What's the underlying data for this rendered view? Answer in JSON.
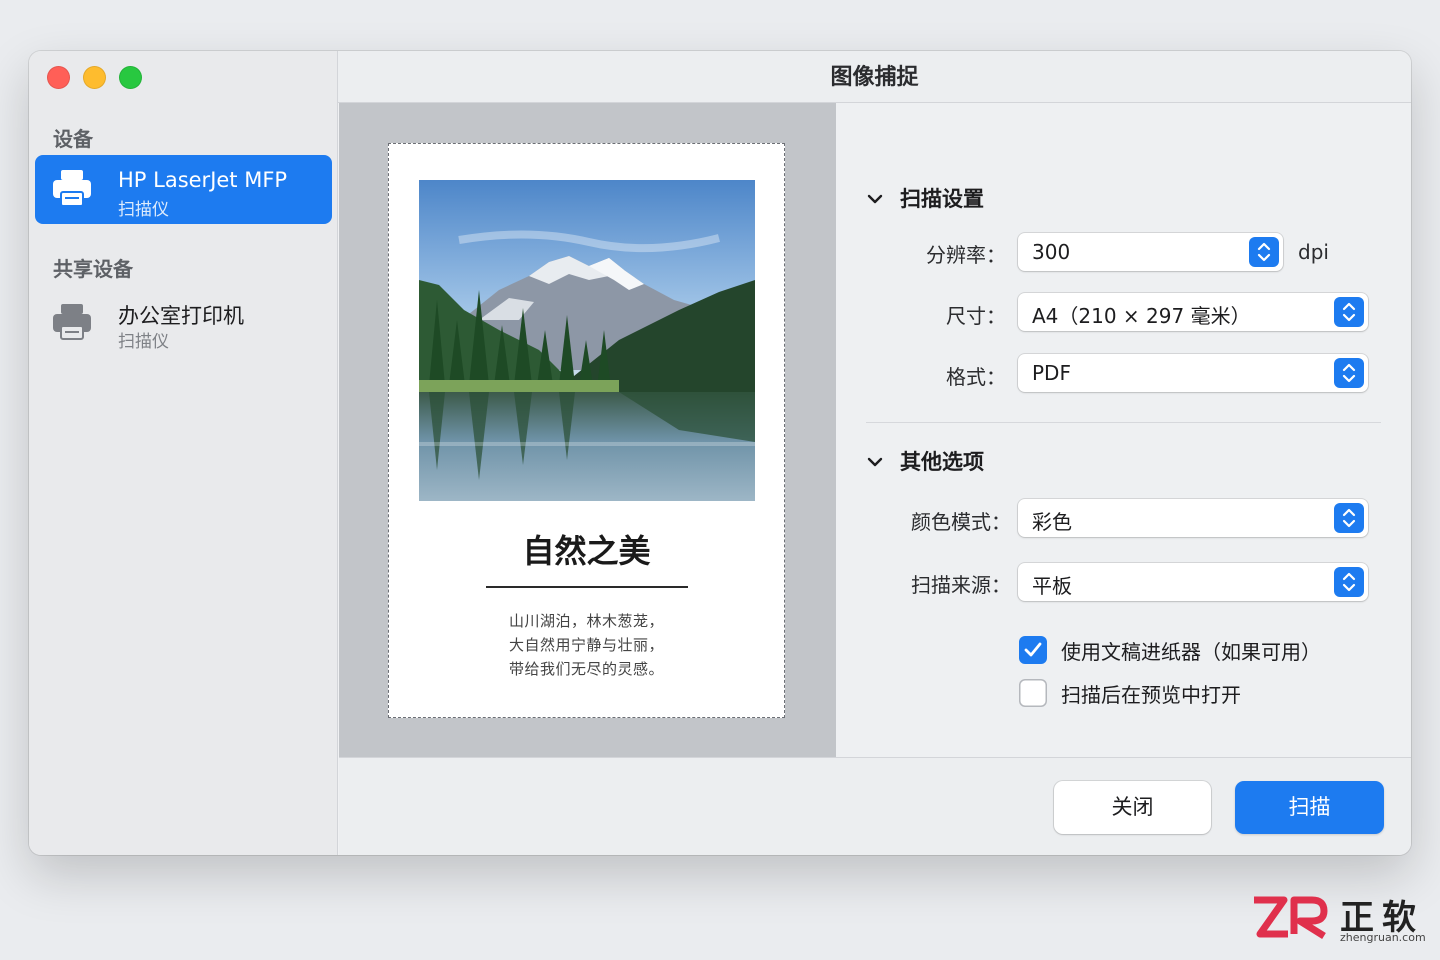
{
  "window": {
    "title": "图像捕捉"
  },
  "sidebar": {
    "devices_header": "设备",
    "devices": [
      {
        "name": "HP LaserJet MFP",
        "type": "扫描仪",
        "selected": true
      }
    ],
    "shared_header": "共享设备",
    "shared": [
      {
        "name": "办公室打印机",
        "type": "扫描仪",
        "selected": false
      }
    ]
  },
  "preview": {
    "title": "自然之美",
    "lines": [
      "山川湖泊，林木葱茏，",
      "大自然用宁静与壮丽，",
      "带给我们无尽的灵感。"
    ]
  },
  "settings": {
    "scan_header": "扫描设置",
    "resolution": {
      "label": "分辨率：",
      "value": "300",
      "unit": "dpi"
    },
    "size": {
      "label": "尺寸：",
      "value": "A4（210 × 297 毫米）"
    },
    "format": {
      "label": "格式：",
      "value": "PDF"
    },
    "other_header": "其他选项",
    "color_mode": {
      "label": "颜色模式：",
      "value": "彩色"
    },
    "source": {
      "label": "扫描来源：",
      "value": "平板"
    },
    "use_feeder": {
      "label": "使用文稿进纸器（如果可用）",
      "checked": true
    },
    "open_preview": {
      "label": "扫描后在预览中打开",
      "checked": false
    }
  },
  "footer": {
    "close_label": "关闭",
    "scan_label": "扫描"
  },
  "watermark": {
    "brand": "正软",
    "url": "zhengruan.com"
  },
  "colors": {
    "accent": "#1d7bf0",
    "close": "#ff5f57",
    "minimize": "#febc2e",
    "zoom": "#28c840"
  }
}
